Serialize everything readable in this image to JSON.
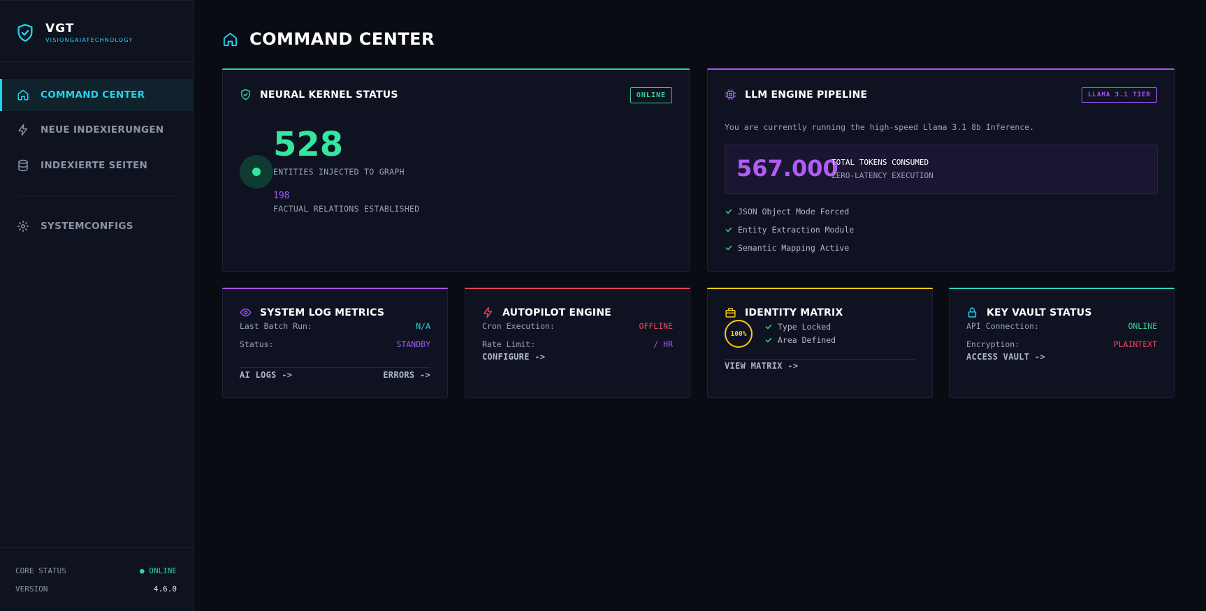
{
  "brand": {
    "name": "VGT",
    "subtitle": "VISIONGAIATECHNOLOGY"
  },
  "nav": {
    "items": [
      {
        "label": "COMMAND CENTER",
        "icon": "home-icon"
      },
      {
        "label": "NEUE INDEXIERUNGEN",
        "icon": "lightning-icon"
      },
      {
        "label": "INDEXIERTE SEITEN",
        "icon": "database-icon"
      },
      {
        "label": "SYSTEMCONFIGS",
        "icon": "gear-icon"
      }
    ]
  },
  "footer": {
    "core_status_label": "CORE STATUS",
    "core_status_value": "● ONLINE",
    "version_label": "VERSION",
    "version_value": "4.6.0"
  },
  "page": {
    "title": "COMMAND CENTER"
  },
  "kernel": {
    "title": "NEURAL KERNEL STATUS",
    "badge": "ONLINE",
    "entities_value": "528",
    "entities_label": "ENTITIES INJECTED TO GRAPH",
    "relations_value": "198",
    "relations_label": "FACTUAL RELATIONS ESTABLISHED"
  },
  "llm": {
    "title": "LLM ENGINE PIPELINE",
    "badge": "LLAMA 3.1 TIER",
    "description": "You are currently running the high-speed Llama 3.1 8b Inference.",
    "tokens_value": "567.000",
    "tokens_label": "TOTAL TOKENS CONSUMED",
    "tokens_sub": "ZERO-LATENCY EXECUTION",
    "checks": [
      "JSON Object Mode Forced",
      "Entity Extraction Module",
      "Semantic Mapping Active"
    ]
  },
  "syslog": {
    "title": "SYSTEM LOG METRICS",
    "row1_label": "Last Batch Run:",
    "row1_value": "N/A",
    "row2_label": "Status:",
    "row2_value": "STANDBY",
    "link1": "AI LOGS ->",
    "link2": "ERRORS ->"
  },
  "autopilot": {
    "title": "AUTOPILOT ENGINE",
    "row1_label": "Cron Execution:",
    "row1_value": "OFFLINE",
    "row2_label": "Rate Limit:",
    "row2_value": "/ HR",
    "link": "CONFIGURE ->"
  },
  "identity": {
    "title": "IDENTITY MATRIX",
    "percent": "100%",
    "checks": [
      "Type Locked",
      "Area Defined"
    ],
    "link": "VIEW MATRIX ->"
  },
  "vault": {
    "title": "KEY VAULT STATUS",
    "row1_label": "API Connection:",
    "row1_value": "ONLINE",
    "row2_label": "Encryption:",
    "row2_value": "PLAINTEXT",
    "link": "ACCESS VAULT ->"
  },
  "colors": {
    "cyan": "#22d3ee",
    "green": "#34d399",
    "purple": "#a855f7",
    "red": "#f43f5e",
    "yellow": "#facc15",
    "teal": "#2dd4bf"
  }
}
